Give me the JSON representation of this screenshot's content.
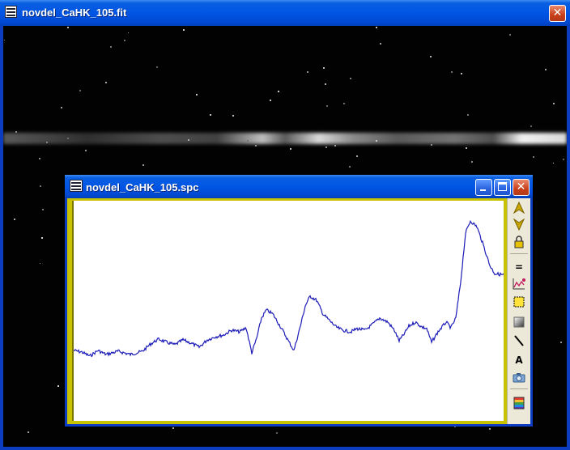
{
  "main_window": {
    "title": "novdel_CaHK_105.fit"
  },
  "spectrum_window": {
    "title": "novdel_CaHK_105.spc"
  },
  "toolbar": {
    "text_label": "A",
    "equals_label": "="
  },
  "colors": {
    "plot_line": "#1b1bb8",
    "frame_border": "#c8c200"
  },
  "plot": {
    "profile": [
      [
        0,
        185
      ],
      [
        10,
        187
      ],
      [
        20,
        192
      ],
      [
        30,
        185
      ],
      [
        40,
        190
      ],
      [
        55,
        186
      ],
      [
        70,
        190
      ],
      [
        85,
        186
      ],
      [
        95,
        177
      ],
      [
        105,
        171
      ],
      [
        115,
        175
      ],
      [
        125,
        178
      ],
      [
        135,
        172
      ],
      [
        145,
        176
      ],
      [
        155,
        181
      ],
      [
        165,
        172
      ],
      [
        175,
        168
      ],
      [
        185,
        166
      ],
      [
        195,
        160
      ],
      [
        205,
        162
      ],
      [
        213,
        157
      ],
      [
        220,
        188
      ],
      [
        226,
        170
      ],
      [
        232,
        145
      ],
      [
        238,
        135
      ],
      [
        246,
        140
      ],
      [
        252,
        150
      ],
      [
        258,
        160
      ],
      [
        265,
        173
      ],
      [
        272,
        185
      ],
      [
        280,
        155
      ],
      [
        286,
        130
      ],
      [
        292,
        118
      ],
      [
        300,
        123
      ],
      [
        308,
        140
      ],
      [
        316,
        148
      ],
      [
        324,
        156
      ],
      [
        332,
        160
      ],
      [
        342,
        162
      ],
      [
        350,
        158
      ],
      [
        360,
        160
      ],
      [
        370,
        152
      ],
      [
        378,
        145
      ],
      [
        388,
        150
      ],
      [
        396,
        160
      ],
      [
        402,
        173
      ],
      [
        408,
        165
      ],
      [
        414,
        155
      ],
      [
        422,
        150
      ],
      [
        430,
        156
      ],
      [
        436,
        158
      ],
      [
        442,
        175
      ],
      [
        450,
        162
      ],
      [
        460,
        150
      ],
      [
        466,
        157
      ],
      [
        472,
        145
      ],
      [
        478,
        100
      ],
      [
        484,
        40
      ],
      [
        490,
        25
      ],
      [
        498,
        32
      ],
      [
        506,
        55
      ],
      [
        514,
        80
      ],
      [
        520,
        90
      ],
      [
        533,
        92
      ]
    ]
  }
}
